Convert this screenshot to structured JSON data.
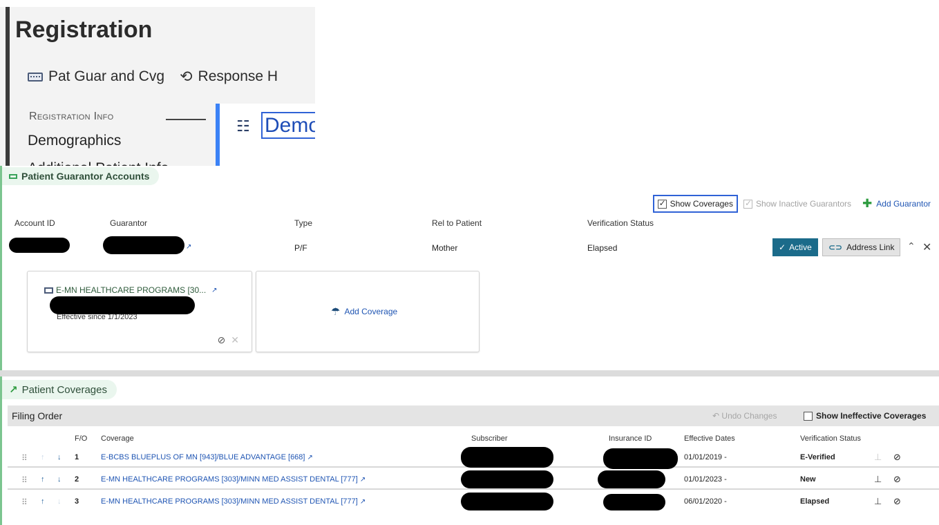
{
  "registration": {
    "title": "Registration",
    "toolbar": [
      {
        "label": "Pat Guar and Cvg",
        "icon": "keyboard-icon"
      },
      {
        "label": "Response H",
        "icon": "history-icon"
      }
    ],
    "section_label": "Registration Info",
    "nav_items": [
      "Demographics",
      "Additional Patient Info"
    ],
    "active_tab": "Demo"
  },
  "guarantor_accounts": {
    "title": "Patient Guarantor Accounts",
    "show_coverages": "Show Coverages",
    "show_inactive_guarantors": "Show Inactive Guarantors",
    "add_guarantor": "Add Guarantor",
    "columns": {
      "account_id": "Account ID",
      "guarantor": "Guarantor",
      "type": "Type",
      "rel_to_patient": "Rel to Patient",
      "verification_status": "Verification Status"
    },
    "row": {
      "type": "P/F",
      "rel_to_patient": "Mother",
      "verification_status": "Elapsed",
      "active_label": "Active",
      "address_link_label": "Address Link"
    },
    "coverage_card": {
      "name": "E-MN HEALTHCARE PROGRAMS [30...",
      "effective": "Effective since 1/1/2023"
    },
    "add_coverage": "Add Coverage"
  },
  "patient_coverages": {
    "title": "Patient Coverages",
    "filing_order": "Filing Order",
    "undo_changes": "Undo Changes",
    "show_ineffective": "Show Ineffective Coverages",
    "columns": {
      "fo": "F/O",
      "coverage": "Coverage",
      "subscriber": "Subscriber",
      "insurance_id": "Insurance ID",
      "effective_dates": "Effective Dates",
      "verification_status": "Verification Status"
    },
    "rows": [
      {
        "fo": "1",
        "coverage": "E-BCBS BLUEPLUS OF MN [943]/BLUE ADVANTAGE [668]",
        "effective": "01/01/2019 -",
        "status": "E-Verified"
      },
      {
        "fo": "2",
        "coverage": "E-MN HEALTHCARE PROGRAMS [303]/MINN MED ASSIST DENTAL [777]",
        "effective": "01/01/2023 -",
        "status": "New"
      },
      {
        "fo": "3",
        "coverage": "E-MN HEALTHCARE PROGRAMS [303]/MINN MED ASSIST DENTAL [777]",
        "effective": "06/01/2020 -",
        "status": "Elapsed"
      }
    ]
  }
}
